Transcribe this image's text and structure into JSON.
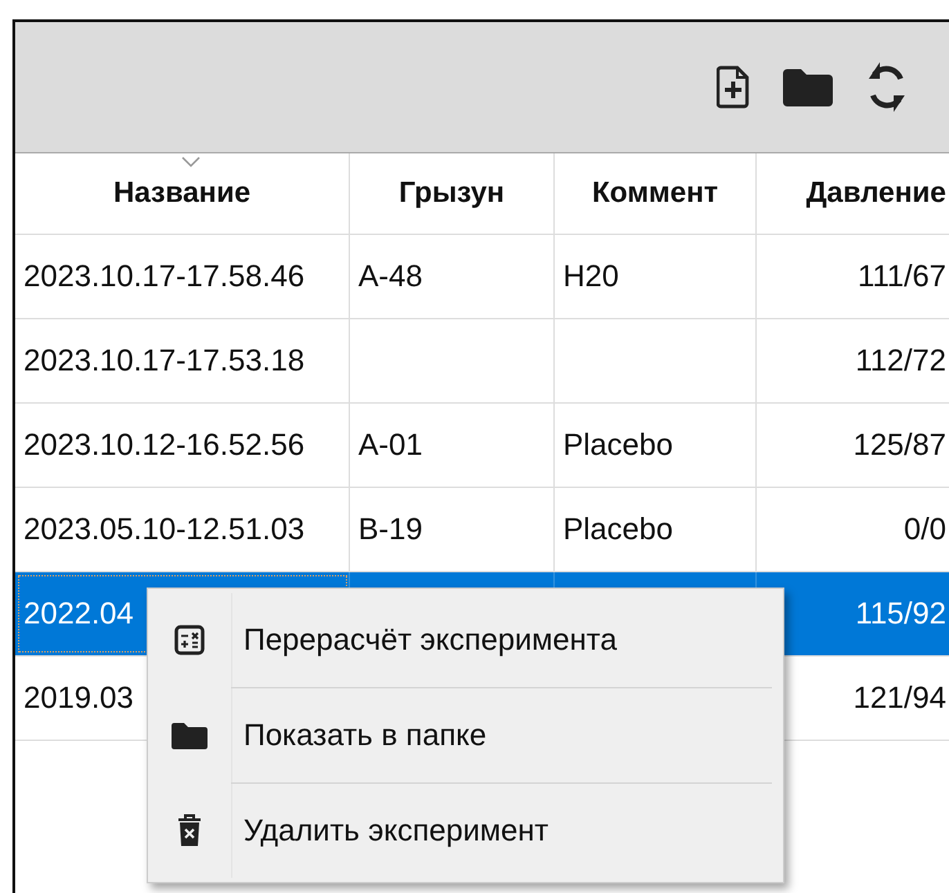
{
  "toolbar": {
    "buttons": [
      {
        "kind": "new-file"
      },
      {
        "kind": "folder"
      },
      {
        "kind": "refresh"
      }
    ]
  },
  "table": {
    "columns": [
      {
        "label": "Название",
        "sorted": true,
        "numeric": false
      },
      {
        "label": "Грызун",
        "sorted": false,
        "numeric": false
      },
      {
        "label": "Коммент",
        "sorted": false,
        "numeric": false
      },
      {
        "label": "Давление",
        "sorted": false,
        "numeric": true
      }
    ],
    "rows": [
      {
        "selected": false,
        "cells": [
          "2023.10.17-17.58.46",
          "A-48",
          "H20",
          "111/67"
        ]
      },
      {
        "selected": false,
        "cells": [
          "2023.10.17-17.53.18",
          "",
          "",
          "112/72"
        ]
      },
      {
        "selected": false,
        "cells": [
          "2023.10.12-16.52.56",
          "A-01",
          "Placebo",
          "125/87"
        ]
      },
      {
        "selected": false,
        "cells": [
          "2023.05.10-12.51.03",
          "B-19",
          "Placebo",
          "0/0"
        ]
      },
      {
        "selected": true,
        "cells": [
          "2022.04",
          "",
          "",
          "115/92"
        ]
      },
      {
        "selected": false,
        "cells": [
          "2019.03",
          "",
          "",
          "121/94"
        ]
      }
    ]
  },
  "context_menu": {
    "items": [
      {
        "kind": "recalc",
        "label": "Перерасчёт эксперимента"
      },
      {
        "kind": "folder",
        "label": "Показать в папке"
      },
      {
        "kind": "delete",
        "label": "Удалить эксперимент"
      }
    ]
  }
}
